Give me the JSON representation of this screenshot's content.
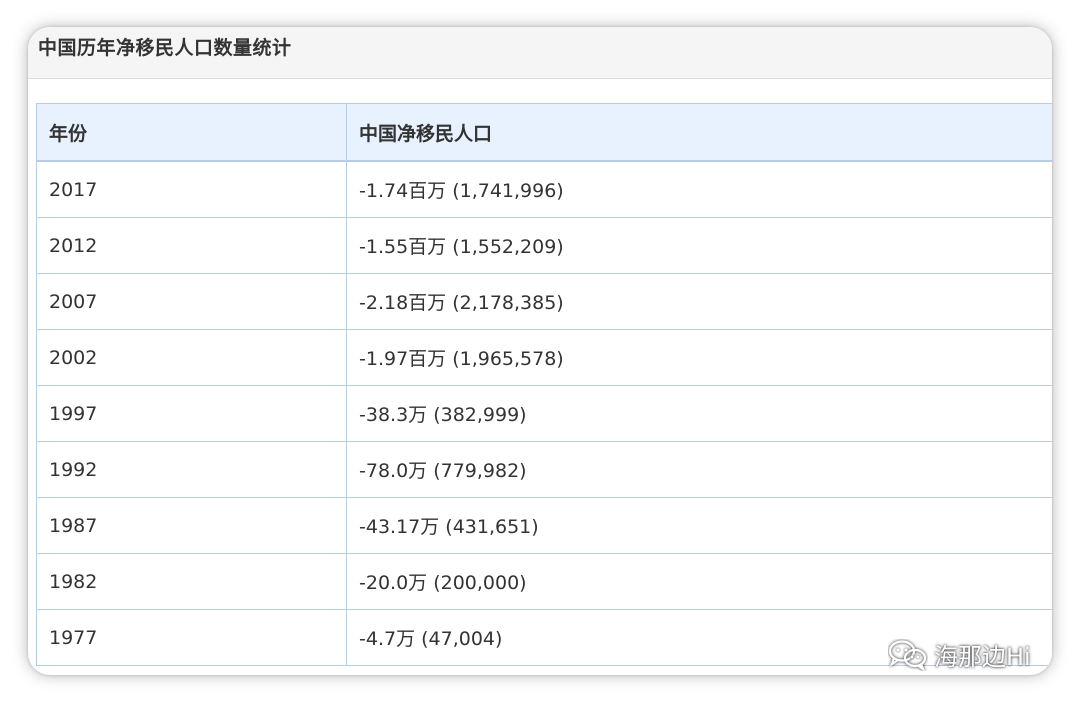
{
  "title": "中国历年净移民人口数量统计",
  "table": {
    "headers": [
      "年份",
      "中国净移民人口"
    ],
    "rows": [
      {
        "year": "2017",
        "value": "-1.74百万 (1,741,996)"
      },
      {
        "year": "2012",
        "value": "-1.55百万 (1,552,209)"
      },
      {
        "year": "2007",
        "value": "-2.18百万 (2,178,385)"
      },
      {
        "year": "2002",
        "value": "-1.97百万 (1,965,578)"
      },
      {
        "year": "1997",
        "value": "-38.3万 (382,999)"
      },
      {
        "year": "1992",
        "value": "-78.0万 (779,982)"
      },
      {
        "year": "1987",
        "value": "-43.17万 (431,651)"
      },
      {
        "year": "1982",
        "value": "-20.0万 (200,000)"
      },
      {
        "year": "1977",
        "value": "-4.7万 (47,004)"
      }
    ]
  },
  "watermark": {
    "icon": "wechat-icon",
    "text": "海那边Hi"
  }
}
